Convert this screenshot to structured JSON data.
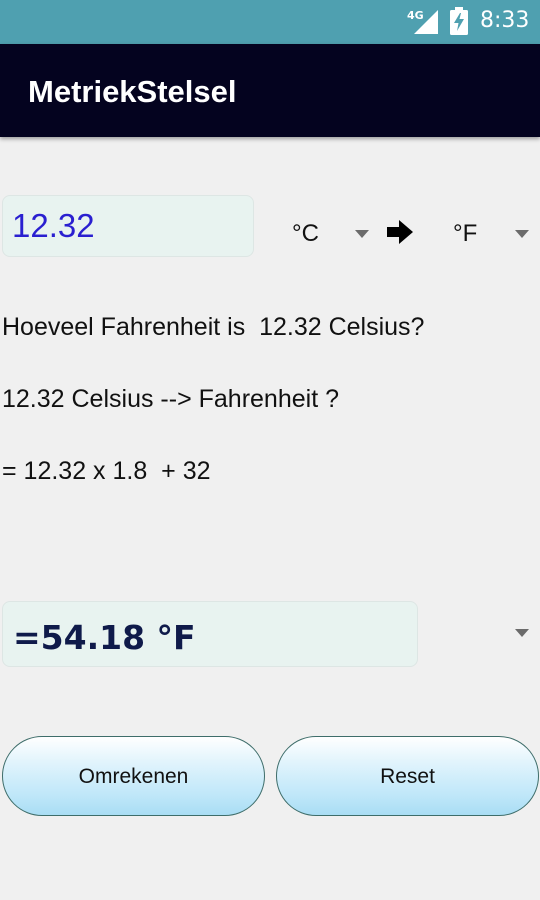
{
  "status_bar": {
    "network": "4G",
    "time": "8:33",
    "icons": [
      "signal-icon",
      "battery-charging-icon"
    ]
  },
  "app_bar": {
    "title": "MetriekStelsel"
  },
  "converter": {
    "input_value": "12.32",
    "from_unit": "°C",
    "to_unit": "°F",
    "arrow_icon": "arrow-right-icon"
  },
  "explanation": {
    "question": "Hoeveel Fahrenheit is  12.32 Celsius?",
    "conversion": "12.32 Celsius --> Fahrenheit ?",
    "formula": "= 12.32 x 1.8  + 32"
  },
  "result": {
    "text": "=54.18 °F"
  },
  "buttons": {
    "convert_label": "Omrekenen",
    "reset_label": "Reset"
  },
  "colors": {
    "status_bar": "#4fa0b0",
    "app_bar": "#04031f",
    "input_text": "#2a1fd0",
    "result_text": "#0f1a4a",
    "field_background": "#e8f3f0"
  }
}
